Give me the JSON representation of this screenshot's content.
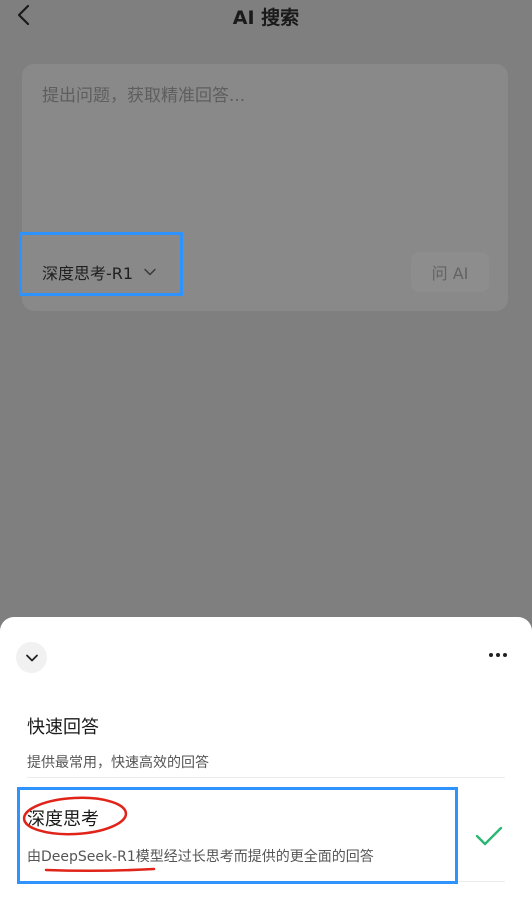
{
  "nav": {
    "title": "AI 搜索",
    "back_icon": "chevron-left-icon"
  },
  "composer": {
    "placeholder": "提出问题，获取精准回答...",
    "model_label": "深度思考-R1",
    "model_icon": "chevron-down-icon",
    "ask_label": "问 AI"
  },
  "sheet": {
    "collapse_icon": "chevron-down-icon",
    "more_icon": "more-horizontal-icon",
    "options": [
      {
        "title": "快速回答",
        "desc": "提供最常用，快速高效的回答",
        "selected": false
      },
      {
        "title": "深度思考",
        "desc": "由DeepSeek-R1模型经过长思考而提供的更全面的回答",
        "selected": true
      }
    ]
  },
  "colors": {
    "overlay": "#7f7f7f",
    "highlight_box": "#2f93ff",
    "annotation_red": "#e0241a",
    "check_green": "#2bb673"
  }
}
